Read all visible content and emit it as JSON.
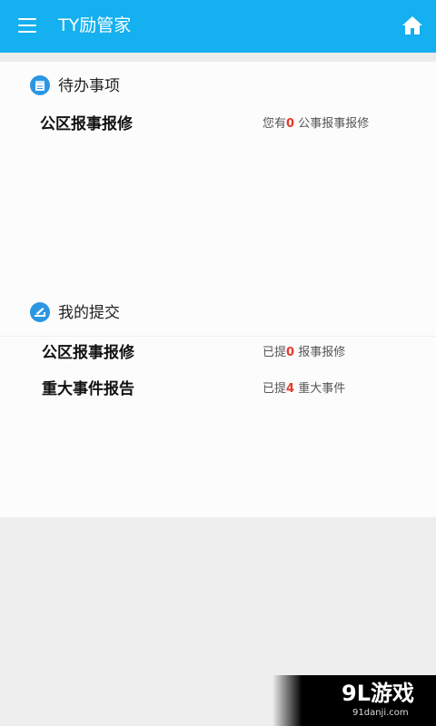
{
  "app_bar": {
    "title": "TY励管家",
    "menu_icon": "hamburger-menu-icon",
    "home_icon": "home-icon",
    "color": "#14b0f0"
  },
  "todo_section": {
    "title": "待办事项",
    "icon": "calendar-icon",
    "items": [
      {
        "label": "公区报事报修",
        "prefix": "您有",
        "count": "0",
        "suffix": " 公事报事报修"
      }
    ]
  },
  "submit_section": {
    "title": "我的提交",
    "icon": "submit-icon",
    "items": [
      {
        "label": "公区报事报修",
        "prefix": "已提",
        "count": "0",
        "suffix": " 报事报修"
      },
      {
        "label": "重大事件报告",
        "prefix": "已提",
        "count": "4",
        "suffix": " 重大事件"
      }
    ]
  },
  "watermark": {
    "text": "9L游戏",
    "sub": "91danji.com"
  },
  "colors": {
    "accent": "#14b0f0",
    "count_highlight": "#e53a2b",
    "icon_blue": "#2b97e3"
  }
}
